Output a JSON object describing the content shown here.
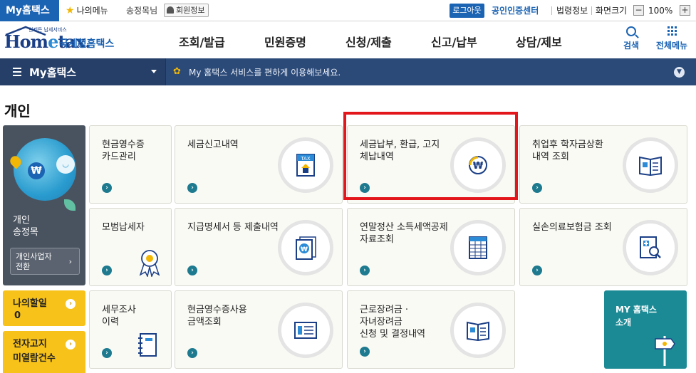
{
  "topbar": {
    "my_tab": "My홈택스",
    "favorites": "나의메뉴",
    "user": "송정목님",
    "member_info": "회원정보",
    "logout": "로그아웃",
    "cert_center": "공인인증센터",
    "law_info": "법령정보",
    "zoom_label": "화면크기",
    "zoom_minus": "−",
    "zoom_plus": "+",
    "zoom_value": "100%"
  },
  "header": {
    "logo_main_a": "Hom",
    "logo_main_e": "e",
    "logo_main_b": "tax.",
    "logo_tagline": "언제든 납세서비스",
    "logo_sub": "국세청홈택스",
    "nav": [
      "조회/발급",
      "민원증명",
      "신청/제출",
      "신고/납부",
      "상담/제보"
    ],
    "search": "검색",
    "all_menu": "전체메뉴"
  },
  "band": {
    "title": "My홈택스",
    "message": "My 홈택스 서비스를 편하게 이용해보세요."
  },
  "page": {
    "section_title": "개인",
    "profile_type": "개인",
    "profile_name": "송정목",
    "switch_line1": "개인사업자",
    "switch_line2": "전환",
    "todo_label": "나의할일",
    "todo_count": "0",
    "enotice_line1": "전자고지",
    "enotice_line2": "미열람건수"
  },
  "tiles": [
    {
      "line1": "현금영수증",
      "line2": "카드관리",
      "icon": "card-icon"
    },
    {
      "line1": "세금신고내역",
      "line2": "",
      "icon": "tax-document-icon"
    },
    {
      "line1": "세금납부, 환급, 고지",
      "line2": "체납내역",
      "icon": "won-coin-icon"
    },
    {
      "line1": "취업후 학자금상환",
      "line2": "내역 조회",
      "icon": "book-icon"
    },
    {
      "line1": "모범납세자",
      "line2": "",
      "icon": "medal-icon"
    },
    {
      "line1": "지급명세서 등 제출내역",
      "line2": "",
      "icon": "won-document-icon"
    },
    {
      "line1": "연말정산 소득세액공제",
      "line2": "자료조회",
      "icon": "spreadsheet-icon"
    },
    {
      "line1": "실손의료보험금 조회",
      "line2": "",
      "icon": "medical-search-icon"
    },
    {
      "line1": "세무조사",
      "line2": "이력",
      "icon": "notebook-icon"
    },
    {
      "line1": "현금영수증사용",
      "line2": "금액조회",
      "icon": "receipt-icon"
    },
    {
      "line1": "근로장려금 ·",
      "line2": "자녀장려금",
      "line3": "신청 및 결정내역",
      "icon": "booklet-icon"
    }
  ],
  "teal": {
    "line1": "MY 홈택스",
    "line2": "소개"
  },
  "colors": {
    "brand_blue": "#1b63b3",
    "band_navy": "#2c4a78",
    "highlight_red": "#e3161c",
    "accent_yellow": "#f7c21a",
    "teal": "#1c8a95"
  }
}
